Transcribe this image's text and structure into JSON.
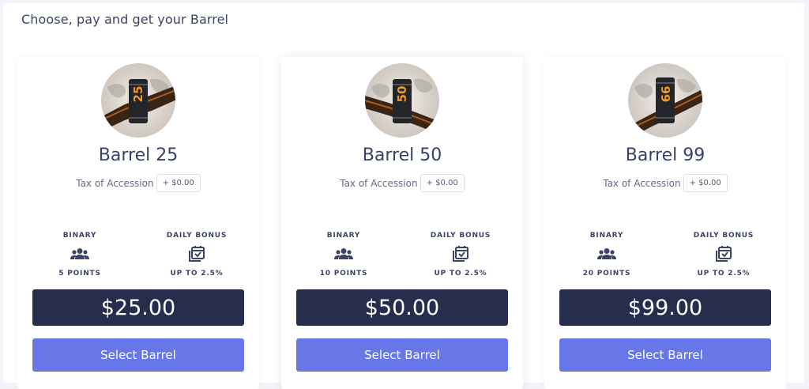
{
  "page": {
    "title": "Choose, pay and get your Barrel"
  },
  "colors": {
    "price_bar": "#272d4d",
    "select_button": "#6777e8",
    "heading": "#39406a"
  },
  "plans": [
    {
      "name": "Barrel 25",
      "barrel_number": "25",
      "tax_label": "Tax of Accession",
      "tax_value": "+ $0.00",
      "binary_label": "BINARY",
      "binary_icon": "users-icon",
      "binary_value": "5 POINTS",
      "bonus_label": "DAILY BONUS",
      "bonus_icon": "calendar-check-icon",
      "bonus_value": "UP TO 2.5%",
      "price": "$25.00",
      "button_label": "Select Barrel"
    },
    {
      "name": "Barrel 50",
      "barrel_number": "50",
      "tax_label": "Tax of Accession",
      "tax_value": "+ $0.00",
      "binary_label": "BINARY",
      "binary_icon": "users-icon",
      "binary_value": "10 POINTS",
      "bonus_label": "DAILY BONUS",
      "bonus_icon": "calendar-check-icon",
      "bonus_value": "UP TO 2.5%",
      "price": "$50.00",
      "button_label": "Select Barrel"
    },
    {
      "name": "Barrel 99",
      "barrel_number": "99",
      "tax_label": "Tax of Accession",
      "tax_value": "+ $0.00",
      "binary_label": "BINARY",
      "binary_icon": "users-icon",
      "binary_value": "20 POINTS",
      "bonus_label": "DAILY BONUS",
      "bonus_icon": "calendar-check-icon",
      "bonus_value": "UP TO 2.5%",
      "price": "$99.00",
      "button_label": "Select Barrel"
    }
  ]
}
